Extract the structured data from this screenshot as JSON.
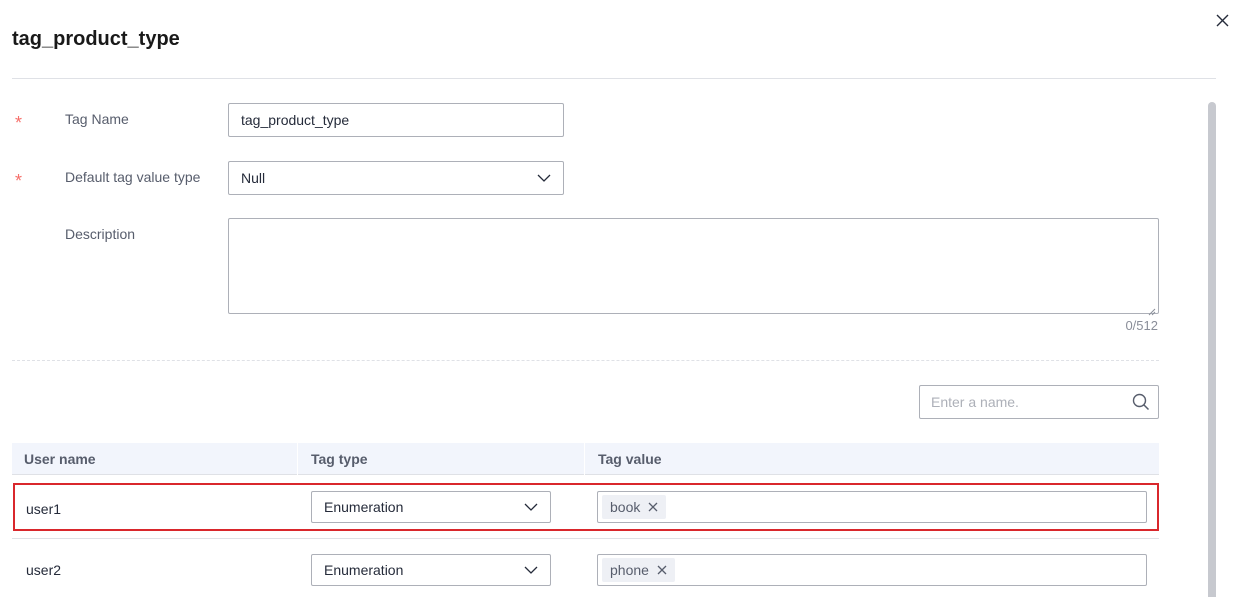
{
  "dialog": {
    "title": "tag_product_type"
  },
  "form": {
    "tag_name": {
      "label": "Tag Name",
      "value": "tag_product_type",
      "required_mark": "*"
    },
    "default_type": {
      "label": "Default tag value type",
      "value": "Null",
      "required_mark": "*"
    },
    "description": {
      "label": "Description",
      "value": "",
      "counter": "0/512"
    }
  },
  "search": {
    "placeholder": "Enter a name."
  },
  "table": {
    "columns": [
      "User name",
      "Tag type",
      "Tag value"
    ],
    "rows": [
      {
        "user": "user1",
        "tag_type": "Enumeration",
        "tags": [
          "book"
        ],
        "highlighted": true
      },
      {
        "user": "user2",
        "tag_type": "Enumeration",
        "tags": [
          "phone"
        ],
        "highlighted": false
      }
    ]
  },
  "colors": {
    "required": "#f66f6a",
    "highlight_border": "#d9272c",
    "header_bg": "#f2f5fc"
  }
}
